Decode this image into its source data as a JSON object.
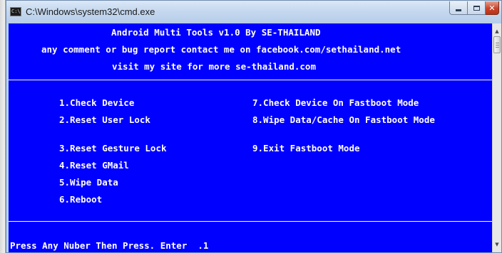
{
  "window": {
    "title": "C:\\Windows\\system32\\cmd.exe",
    "icon_glyph": "C:\\",
    "controls": {
      "minimize": "minimize-icon",
      "maximize": "maximize-icon",
      "close": "close-icon"
    }
  },
  "console": {
    "background": "#0000FE",
    "foreground": "#FFFFFF",
    "header": [
      "Android Multi Tools v1.0 By SE-THAILAND",
      "any comment or bug report contact me on facebook.com/sethailand.net",
      "visit my site for more se-thailand.com"
    ],
    "menu_left": [
      "1.Check Device",
      "2.Reset User Lock",
      "3.Reset Gesture Lock",
      "4.Reset GMail",
      "5.Wipe Data",
      "6.Reboot"
    ],
    "menu_right": [
      "7.Check Device On Fastboot Mode",
      "8.Wipe Data/Cache On Fastboot Mode",
      "9.Exit Fastboot Mode"
    ],
    "prompt": "Press Any Nuber Then Press. Enter  .1"
  }
}
